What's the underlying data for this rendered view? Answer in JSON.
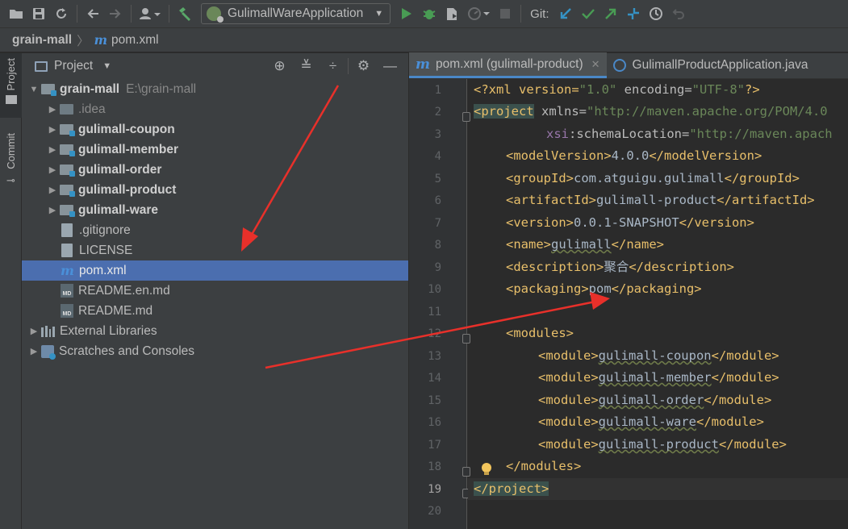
{
  "toolbar": {
    "run_config": "GulimallWareApplication",
    "git_label": "Git:",
    "icons": [
      "open-folder-icon",
      "save-icon",
      "sync-icon",
      "back-icon",
      "forward-icon",
      "vcs-user-icon",
      "build-hammer-icon",
      "run-icon",
      "debug-icon",
      "coverage-icon",
      "profile-icon",
      "stop-icon",
      "git-update-icon",
      "git-commit-icon",
      "git-push-icon",
      "git-fetch-icon",
      "history-icon",
      "rollback-icon"
    ]
  },
  "breadcrumb": {
    "project": "grain-mall",
    "file": "pom.xml"
  },
  "leftstrip": {
    "project_tab": "Project",
    "commit_tab": "Commit"
  },
  "project_panel": {
    "title": "Project",
    "tree": [
      {
        "label": "grain-mall",
        "extra": "E:\\grain-mall",
        "kind": "root",
        "expanded": true
      },
      {
        "label": ".idea",
        "kind": "folder"
      },
      {
        "label": "gulimall-coupon",
        "kind": "module"
      },
      {
        "label": "gulimall-member",
        "kind": "module"
      },
      {
        "label": "gulimall-order",
        "kind": "module"
      },
      {
        "label": "gulimall-product",
        "kind": "module"
      },
      {
        "label": "gulimall-ware",
        "kind": "module"
      },
      {
        "label": ".gitignore",
        "kind": "file"
      },
      {
        "label": "LICENSE",
        "kind": "file"
      },
      {
        "label": "pom.xml",
        "kind": "maven",
        "selected": true
      },
      {
        "label": "README.en.md",
        "kind": "md"
      },
      {
        "label": "README.md",
        "kind": "md"
      },
      {
        "label": "External Libraries",
        "kind": "lib"
      },
      {
        "label": "Scratches and Consoles",
        "kind": "scratch"
      }
    ],
    "md_badge": "MD"
  },
  "editor": {
    "tabs": [
      {
        "label": "pom.xml (gulimall-product)",
        "active": true
      },
      {
        "label": "GulimallProductApplication.java",
        "active": false
      }
    ],
    "current_line": 19,
    "line_numbers": [
      "1",
      "2",
      "3",
      "4",
      "5",
      "6",
      "7",
      "8",
      "9",
      "10",
      "11",
      "12",
      "13",
      "14",
      "15",
      "16",
      "17",
      "18",
      "19",
      "20"
    ],
    "code": {
      "l1_decl": "<?xml version=",
      "l1_v1": "\"1.0\"",
      "l1_enc": " encoding=",
      "l1_v2": "\"UTF-8\"",
      "l1_end": "?>",
      "l2_tag": "<project",
      "l2_attr": " xmlns=",
      "l2_val": "\"http://maven.apache.org/POM/4.0",
      "l3_ns": "xsi",
      "l3_attr": ":schemaLocation=",
      "l3_val": "\"http://maven.apach",
      "model_open": "<modelVersion>",
      "model_val": "4.0.0",
      "model_close": "</modelVersion>",
      "group_open": "<groupId>",
      "group_val": "com.atguigu.gulimall",
      "group_close": "</groupId>",
      "artifact_open": "<artifactId>",
      "artifact_val": "gulimall-product",
      "artifact_close": "</artifactId>",
      "version_open": "<version>",
      "version_val": "0.0.1-SNAPSHOT",
      "version_close": "</version>",
      "name_open": "<name>",
      "name_val": "gulimall",
      "name_close": "</name>",
      "desc_open": "<description>",
      "desc_val": "聚合",
      "desc_close": "</description>",
      "pack_open": "<packaging>",
      "pack_val": "pom",
      "pack_close": "</packaging>",
      "modules_open": "<modules>",
      "modules": [
        "gulimall-coupon",
        "gulimall-member",
        "gulimall-order",
        "gulimall-ware",
        "gulimall-product"
      ],
      "module_open": "<module>",
      "module_close": "</module>",
      "modules_close": "</modules>",
      "project_close": "</project>"
    }
  },
  "colors": {
    "tag": "#e8bf6a",
    "string": "#6a8759",
    "selection": "#4b6eaf",
    "annotation_arrow": "#e8302a"
  }
}
